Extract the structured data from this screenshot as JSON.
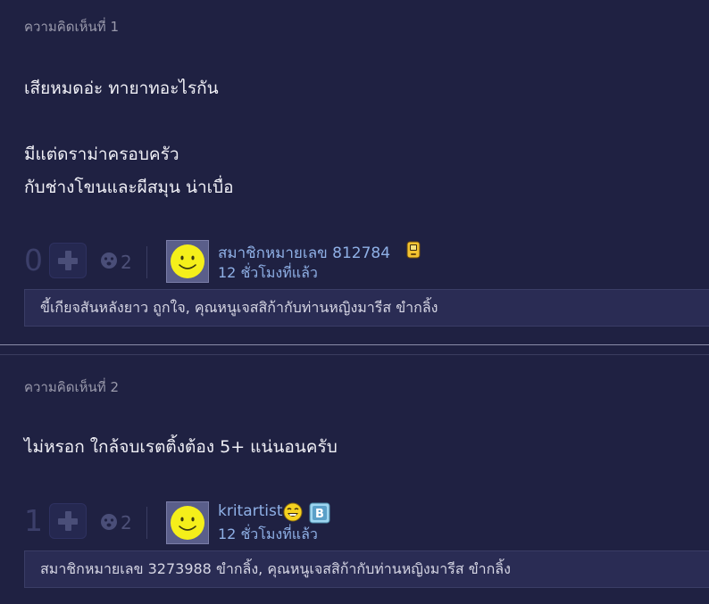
{
  "comments": [
    {
      "label": "ความคิดเห็นที่ 1",
      "body": [
        "เสียหมดอ่ะ ทายาทอะไรกัน",
        "",
        "มีแต่ดราม่าครอบครัว",
        "กับช่างโขนและผีสมุน น่าเบื่อ"
      ],
      "vote_count": "0",
      "emotion_count": "2",
      "username": "สมาชิกหมายเลข 812784",
      "badges": [
        "phone-badge-icon"
      ],
      "timestamp": "12 ชั่วโมงที่แล้ว",
      "reactors": "ขี้เกียจสันหลังยาว ถูกใจ, คุณหนูเจสสิก้ากับท่านหญิงมารีส ขำกลิ้ง"
    },
    {
      "label": "ความคิดเห็นที่ 2",
      "body": [
        "ไม่หรอก ใกล้จบเรตติ้งต้อง 5+ แน่นอนครับ"
      ],
      "vote_count": "1",
      "emotion_count": "2",
      "username": "kritartist",
      "badges": [
        "laughing-emoji-badge-icon",
        "blogger-badge-icon"
      ],
      "timestamp": "12 ชั่วโมงที่แล้ว",
      "reactors": "สมาชิกหมายเลข 3273988 ขำกลิ้ง, คุณหนูเจสสิก้ากับท่านหญิงมารีส ขำกลิ้ง"
    }
  ],
  "colors": {
    "background": "#1f2142",
    "username": "#8fb0e6",
    "reaction_bar": "#2a2c54",
    "avatar_face": "#f5ef1a"
  }
}
